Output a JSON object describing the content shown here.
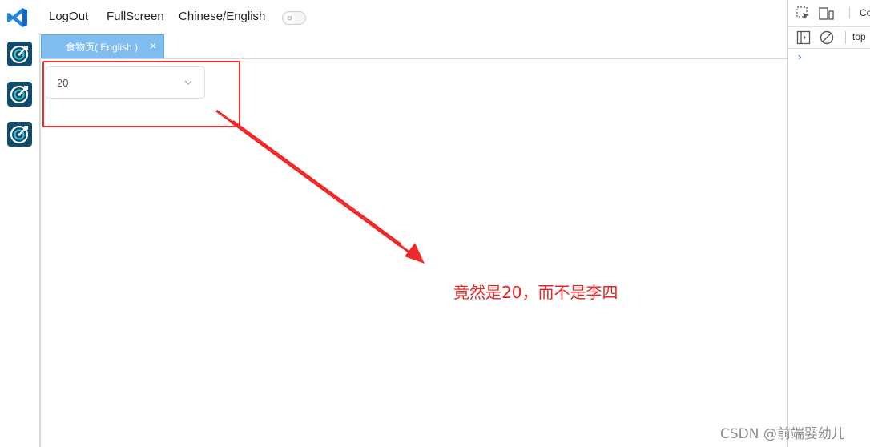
{
  "topbar": {
    "logo_icon": "vscode-logo-icon",
    "menu": [
      {
        "label": "LogOut"
      },
      {
        "label": "FullScreen"
      },
      {
        "label": "Chinese/English"
      }
    ],
    "theme_toggle_icon": "sun-icon"
  },
  "sidebar": {
    "items": [
      {
        "icon": "target-icon"
      },
      {
        "icon": "target-icon"
      },
      {
        "icon": "target-icon"
      }
    ]
  },
  "tabs": [
    {
      "label": "食物页( English )",
      "close": "×",
      "active": true
    }
  ],
  "select": {
    "value": "20",
    "icon": "chevron-down-icon"
  },
  "annotation": {
    "text": "竟然是20，而不是李四",
    "color": "#e32626"
  },
  "devtools": {
    "tab_label": "Co",
    "context_label": "top",
    "prompt": "›"
  },
  "watermark": "CSDN @前端婴幼儿",
  "colors": {
    "accent": "#7fbdf0",
    "annotation_red": "#ee2b2b",
    "sidebar_icon_bg": "#0f4c6e"
  }
}
